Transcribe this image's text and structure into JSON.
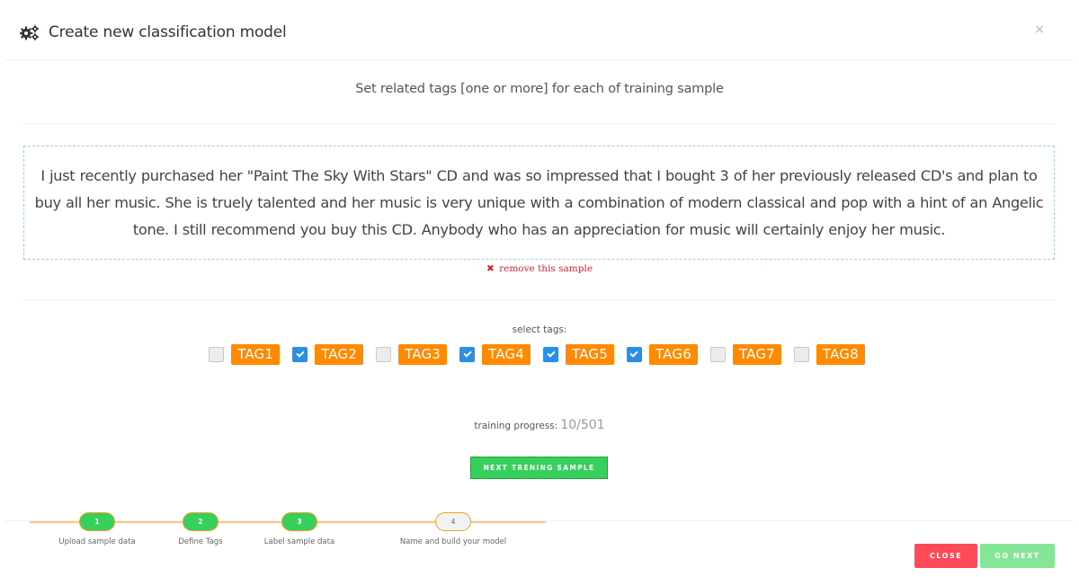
{
  "header": {
    "title": "Create new classification model",
    "icon": "gears-icon",
    "close_label": "×"
  },
  "subtitle": "Set related tags [one or more] for each of training sample",
  "sample": {
    "text": "I just recently purchased her \"Paint The Sky With Stars\" CD and was so impressed that I bought 3 of her previously released CD's and plan to buy all her music. She is truely talented and her music is very unique with a combination of modern classical and pop with a hint of an Angelic tone. I still recommend you buy this CD. Anybody who has an appreciation for music will certainly enjoy her music.",
    "remove_icon": "✖",
    "remove_label": "remove this sample"
  },
  "tags": {
    "label": "select tags:",
    "items": [
      {
        "name": "TAG1",
        "checked": false
      },
      {
        "name": "TAG2",
        "checked": true
      },
      {
        "name": "TAG3",
        "checked": false
      },
      {
        "name": "TAG4",
        "checked": true
      },
      {
        "name": "TAG5",
        "checked": true
      },
      {
        "name": "TAG6",
        "checked": true
      },
      {
        "name": "TAG7",
        "checked": false
      },
      {
        "name": "TAG8",
        "checked": false
      }
    ],
    "tag_color": "#ff8a00",
    "checked_color": "#2a8fe6"
  },
  "progress": {
    "label": "training progress:",
    "value": "10/501",
    "current": 10,
    "total": 501
  },
  "next_sample_button": "NEXT TRENING SAMPLE",
  "steps": [
    {
      "number": "1",
      "label": "Upload sample data",
      "status": "done"
    },
    {
      "number": "2",
      "label": "Define Tags",
      "status": "done"
    },
    {
      "number": "3",
      "label": "Label sample data",
      "status": "done"
    },
    {
      "number": "4",
      "label": "Name and build your model",
      "status": "pending"
    }
  ],
  "footer": {
    "close_label": "CLOSE",
    "next_label": "GO NEXT"
  },
  "colors": {
    "success": "#38d05c",
    "danger": "#ff4a57",
    "accent": "#ff8a00",
    "step_line": "#fcc979"
  }
}
